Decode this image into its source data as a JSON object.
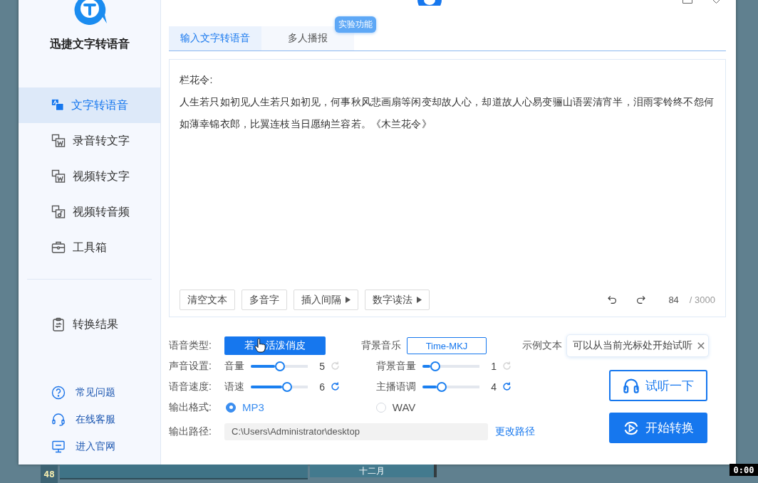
{
  "app": {
    "name": "迅捷文字转语音"
  },
  "sidebar": {
    "items": [
      {
        "label": "文字转语音",
        "selected": true
      },
      {
        "label": "录音转文字",
        "selected": false
      },
      {
        "label": "视频转文字",
        "selected": false
      },
      {
        "label": "视频转音频",
        "selected": false
      },
      {
        "label": "工具箱",
        "selected": false
      },
      {
        "label": "转换结果",
        "selected": false
      }
    ],
    "links": [
      {
        "label": "常见问题"
      },
      {
        "label": "在线客服"
      },
      {
        "label": "进入官网"
      }
    ]
  },
  "tabs": [
    {
      "label": "输入文字转语音",
      "selected": true
    },
    {
      "label": "多人播报",
      "selected": false,
      "badge": "实验功能"
    }
  ],
  "editor": {
    "lines": [
      "栏花令:",
      "人生若只如初见人生若只如初见，何事秋风悲画扇等闲变却故人心，却道故人心易变骊山语罢清宵半，泪雨零铃终不怨何如薄幸锦衣郎，比翼连枝当日愿纳兰容若。《木兰花令》"
    ],
    "tools": [
      {
        "label": "清空文本",
        "menu": false
      },
      {
        "label": "多音字",
        "menu": false
      },
      {
        "label": "插入间隔",
        "menu": true
      },
      {
        "label": "数字读法",
        "menu": true
      }
    ],
    "count": "84",
    "limit": "/ 3000"
  },
  "voice": {
    "label": "语音类型:",
    "value_parts": [
      "若",
      "活泼俏皮"
    ]
  },
  "music": {
    "label": "背景音乐",
    "value": "Time-MKJ"
  },
  "sample": {
    "label": "示例文本",
    "tooltip": "可以从当前光标处开始试听"
  },
  "slider_rows": [
    {
      "label": "声音设置:",
      "sliders": [
        {
          "label": "音量",
          "level": 0.51,
          "value": "5",
          "reset_active": false
        },
        {
          "label": "背景音量",
          "level": 0.22,
          "value": "1",
          "reset_active": false
        }
      ]
    },
    {
      "label": "语音速度:",
      "sliders": [
        {
          "label": "语速",
          "level": 0.64,
          "value": "6",
          "reset_active": true
        },
        {
          "label": "主播语调",
          "level": 0.34,
          "value": "4",
          "reset_active": true
        }
      ]
    }
  ],
  "format": {
    "label": "输出格式:",
    "options": [
      {
        "label": "MP3",
        "selected": true
      },
      {
        "label": "WAV",
        "selected": false
      }
    ]
  },
  "path": {
    "label": "输出路径:",
    "value": "C:\\Users\\Administrator\\desktop",
    "action": "更改路径"
  },
  "buttons": [
    {
      "label": "试听一下",
      "kind": "outline"
    },
    {
      "label": "开始转换",
      "kind": "primary"
    }
  ],
  "desktop": {
    "row_number": "48",
    "month": "十二月",
    "timer": "0:00"
  }
}
